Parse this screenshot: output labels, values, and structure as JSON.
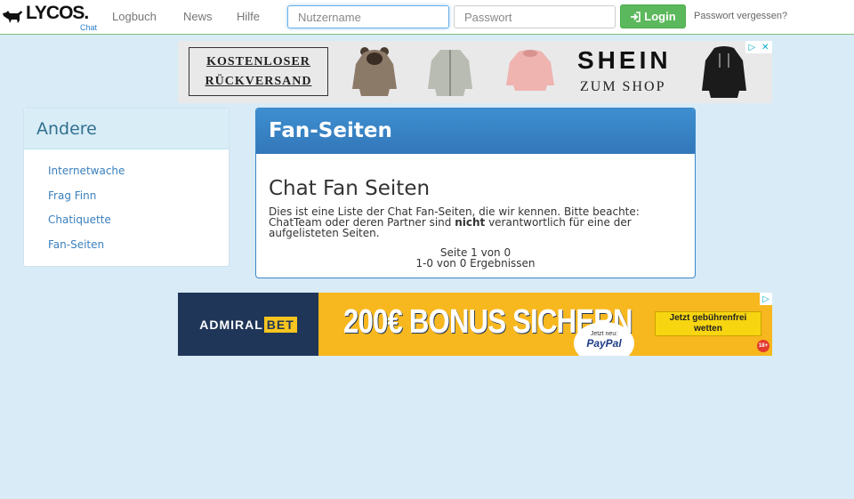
{
  "header": {
    "logo_text": "LYCOS.",
    "logo_sub": "Chat",
    "nav": [
      "Logbuch",
      "News",
      "Hilfe"
    ],
    "username_placeholder": "Nutzername",
    "password_placeholder": "Passwort",
    "login_label": "Login",
    "forgot_label": "Passwort vergessen?"
  },
  "ad_top": {
    "line1": "KOSTENLOSER",
    "line2": "RÜCKVERSAND",
    "brand": "SHEIN",
    "cta": "ZUM SHOP"
  },
  "sidebar": {
    "title": "Andere",
    "items": [
      "Internetwache",
      "Frag Finn",
      "Chatiquette",
      "Fan-Seiten"
    ]
  },
  "main": {
    "panel_title": "Fan-Seiten",
    "heading": "Chat Fan Seiten",
    "desc_before": "Dies ist eine Liste der Chat Fan-Seiten, die wir kennen. Bitte beachte: ChatTeam oder deren Partner sind ",
    "desc_bold": "nicht",
    "desc_after": " verantwortlich für eine der aufgelisteten Seiten.",
    "page_info": "Seite 1 von 0",
    "results_info": "1-0 von 0 Ergebnissen"
  },
  "ad_bottom": {
    "brand_a": "ADMIRAL",
    "brand_b": "BET",
    "headline": "200€ BONUS SICHERN",
    "paypal_top": "Jetzt neu:",
    "paypal_name": "PayPal",
    "cta_line1": "Jetzt gebührenfrei",
    "cta_line2": "wetten",
    "age": "18+"
  },
  "colors": {
    "page_bg": "#d8ebf6",
    "primary": "#3a87c8",
    "login_green": "#5cb85c",
    "link": "#3a7fbd"
  }
}
